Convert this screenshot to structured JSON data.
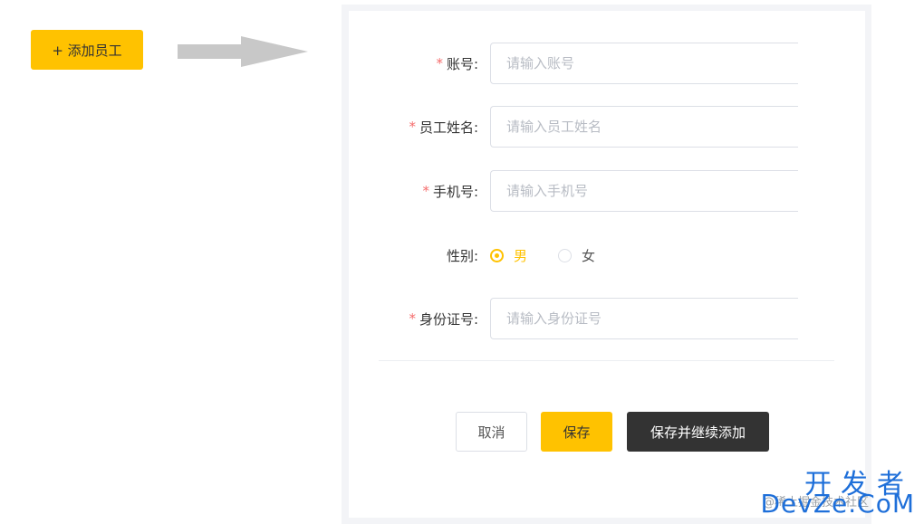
{
  "toolbar": {
    "add_employee_label": "+ 添加员工"
  },
  "form": {
    "account": {
      "label": "账号:",
      "placeholder": "请输入账号",
      "value": ""
    },
    "name": {
      "label": "员工姓名:",
      "placeholder": "请输入员工姓名",
      "value": ""
    },
    "phone": {
      "label": "手机号:",
      "placeholder": "请输入手机号",
      "value": ""
    },
    "gender": {
      "label": "性别:",
      "selected": "男",
      "options": [
        {
          "label": "男"
        },
        {
          "label": "女"
        }
      ]
    },
    "id_number": {
      "label": "身份证号:",
      "placeholder": "请输入身份证号",
      "value": ""
    },
    "required_mark": "*"
  },
  "actions": {
    "cancel_label": "取消",
    "save_label": "保存",
    "save_continue_label": "保存并继续添加"
  },
  "watermark": {
    "big": "开发者",
    "small": "@稀土掘金技术社区",
    "brand": "DevZe.CoM"
  },
  "colors": {
    "accent": "#ffc200",
    "required": "#f56c6c",
    "dark_button": "#333333",
    "watermark": "#1e6fd9",
    "arrow": "#c8c8c8"
  },
  "icons": {
    "arrow": "right-arrow-icon"
  }
}
